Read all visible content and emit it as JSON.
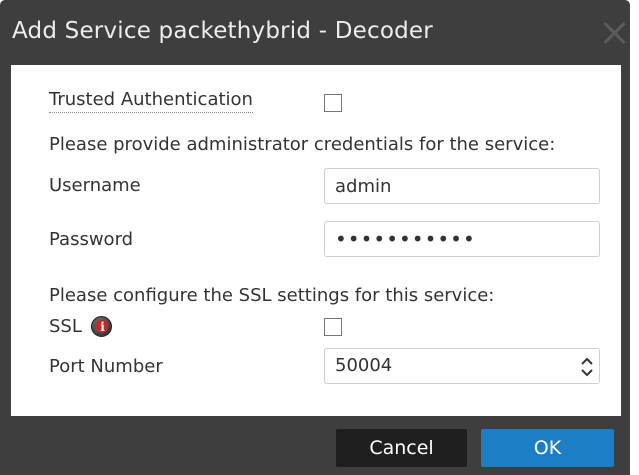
{
  "dialog": {
    "title": "Add Service packethybrid - Decoder",
    "close_icon": "close-icon"
  },
  "form": {
    "trusted_auth_label": "Trusted Authentication",
    "trusted_auth_checked": false,
    "credentials_prompt": "Please provide administrator credentials for the service:",
    "username_label": "Username",
    "username_value": "admin",
    "password_label": "Password",
    "password_value": "•••••••••••",
    "ssl_prompt": "Please configure the SSL settings for this service:",
    "ssl_label": "SSL",
    "ssl_info_icon": "info-icon",
    "ssl_checked": false,
    "port_label": "Port Number",
    "port_value": "50004",
    "port_stepper_icon": "stepper-icon"
  },
  "buttons": {
    "cancel_label": "Cancel",
    "ok_label": "OK"
  },
  "colors": {
    "dialog_background": "#3e3e3e",
    "ok_button": "#1c7fc5",
    "cancel_button": "#1f1f1f"
  }
}
